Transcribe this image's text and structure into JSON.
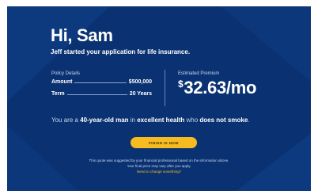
{
  "colors": {
    "background": "#0a3272",
    "accent": "#f6bb20",
    "text": "#ffffff",
    "muted_text": "#c9d5ec"
  },
  "header": {
    "greeting": "Hi, Sam",
    "intro": "Jeff started your application for life insurance."
  },
  "policy": {
    "label": "Policy Details",
    "rows": [
      {
        "label": "Amount",
        "value": "$500,000"
      },
      {
        "label": "Term",
        "value": "20 Years"
      }
    ]
  },
  "premium": {
    "label": "Estimated Premium",
    "currency": "$",
    "amount": "32.63/mo"
  },
  "summary": {
    "prefix": "You are a ",
    "age": "40-year-old man",
    "middle": " in ",
    "health": "excellent health",
    "conjunction": " who ",
    "smoking": "does not smoke",
    "suffix": "."
  },
  "actions": {
    "finish_label": "FINISH IS NOW"
  },
  "disclaimer": {
    "line1": "This quote was suggested by your financial professional based on the information above.",
    "line2": "Your final price may vary after you apply.",
    "link": "Need to change something?"
  }
}
